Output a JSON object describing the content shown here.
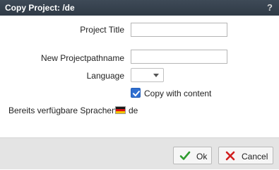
{
  "dialog": {
    "title": "Copy Project: /de",
    "help_glyph": "?"
  },
  "form": {
    "project_title_label": "Project Title",
    "project_title_value": "",
    "new_path_label": "New Projectpathname",
    "new_path_value": "",
    "language_label": "Language",
    "language_value": "",
    "copy_with_content_label": "Copy with content",
    "copy_with_content_checked": true,
    "available_languages_label": "Bereits verfügbare Sprachen:",
    "available_languages": [
      {
        "code": "de",
        "flag_icon": "german-flag-icon"
      }
    ]
  },
  "footer": {
    "ok_label": "Ok",
    "cancel_label": "Cancel"
  },
  "colors": {
    "titlebar": "#36424f",
    "checkbox": "#2f6fd0",
    "ok_icon": "#2e9b2e",
    "cancel_icon": "#d11f1f"
  }
}
